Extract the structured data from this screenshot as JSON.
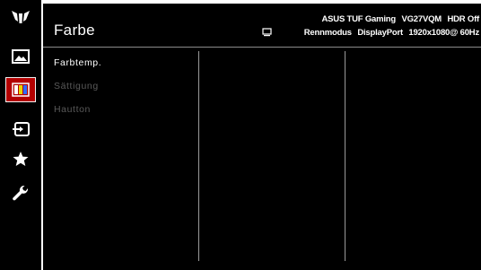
{
  "sidebar": {
    "items": [
      {
        "icon": "tuf-logo-icon",
        "active": false
      },
      {
        "icon": "image-icon",
        "active": false
      },
      {
        "icon": "color-bars-icon",
        "active": true,
        "accent_color": "#b30000"
      },
      {
        "icon": "input-select-icon",
        "active": false
      },
      {
        "icon": "star-icon",
        "active": false
      },
      {
        "icon": "wrench-icon",
        "active": false
      }
    ]
  },
  "header": {
    "title": "Farbe",
    "status_icon": "monitor-icon",
    "status_line1": [
      "ASUS TUF Gaming",
      "VG27VQM",
      "HDR Off"
    ],
    "status_line2": [
      "Rennmodus",
      "DisplayPort",
      "1920x1080@ 60Hz"
    ]
  },
  "menu": {
    "items": [
      {
        "label": "Farbtemp.",
        "enabled": true
      },
      {
        "label": "Sättigung",
        "enabled": false
      },
      {
        "label": "Hautton",
        "enabled": false
      }
    ]
  },
  "colors": {
    "background": "#000000",
    "active_accent": "#b30000",
    "text": "#ffffff",
    "disabled_text": "#5a5a5a"
  }
}
